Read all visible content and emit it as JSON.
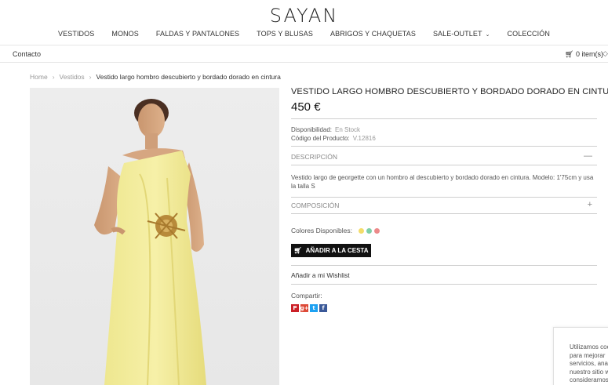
{
  "header": {
    "logo": "SAYAN",
    "nav": [
      {
        "label": "VESTIDOS",
        "sale": false
      },
      {
        "label": "MONOS",
        "sale": false
      },
      {
        "label": "FALDAS Y PANTALONES",
        "sale": false
      },
      {
        "label": "TOPS Y BLUSAS",
        "sale": false
      },
      {
        "label": "ABRIGOS Y CHAQUETAS",
        "sale": false
      },
      {
        "label": "SALE-OUTLET",
        "sale": true
      },
      {
        "label": "COLECCIÓN",
        "sale": false
      }
    ],
    "contact": "Contacto",
    "cart": "0 item(s)"
  },
  "breadcrumb": {
    "home": "Home",
    "category": "Vestidos",
    "current": "Vestido largo hombro descubierto y bordado dorado en cintura"
  },
  "product": {
    "title": "VESTIDO LARGO HOMBRO DESCUBIERTO Y BORDADO DORADO EN CINTURA",
    "price": "450 €",
    "availability_label": "Disponibilidad:",
    "availability_value": "En Stock",
    "code_label": "Código del Producto:",
    "code_value": "V.12816",
    "description_label": "DESCRIPCIÓN",
    "description_text": "Vestido largo de georgette con un hombro al descubierto y bordado dorado en cintura. Modelo: 1'75cm y usa la talla S",
    "composition_label": "COMPOSICIÓN",
    "colors_label": "Colores Disponibles:",
    "colors": [
      "#f3dd6a",
      "#7fcfa8",
      "#ec8a8a"
    ],
    "add_to_cart": "AÑADIR A LA CESTA",
    "wishlist": "Añadir a mi Wishlist",
    "share_label": "Compartir:",
    "social": [
      {
        "icon": "pinterest-icon",
        "glyph": "P",
        "color": "#cb2027"
      },
      {
        "icon": "google-plus-icon",
        "glyph": "g+",
        "color": "#dd4b39"
      },
      {
        "icon": "twitter-icon",
        "glyph": "t",
        "color": "#1da1f2"
      },
      {
        "icon": "facebook-icon",
        "glyph": "f",
        "color": "#3b5998"
      }
    ]
  },
  "cookie": {
    "lines": [
      "Utilizamos coo",
      "para mejorar",
      "servicios, anal",
      "nuestro sitio w",
      "consideramos"
    ]
  }
}
